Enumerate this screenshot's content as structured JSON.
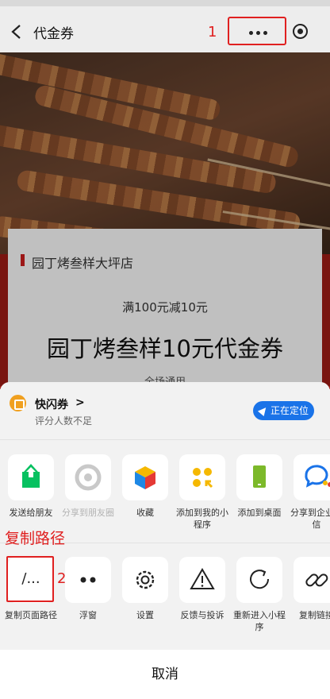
{
  "nav": {
    "title": "代金券",
    "annotation_1": "1"
  },
  "coupon": {
    "shop_name": "园丁烤叁样大坪店",
    "deal": "满100元减10元",
    "title": "园丁烤叁样10元代金券",
    "scope": "全场通用"
  },
  "sheet": {
    "app_name": "快闪券",
    "app_chevron": ">",
    "rating": "评分人数不足",
    "locating": "正在定位",
    "row1": [
      {
        "label": "发送给朋友",
        "icon": "share-arrow-icon"
      },
      {
        "label": "分享到朋友圈",
        "icon": "moments-icon"
      },
      {
        "label": "收藏",
        "icon": "favorite-cube-icon"
      },
      {
        "label": "添加到我的小程序",
        "icon": "my-mini-program-icon"
      },
      {
        "label": "添加到桌面",
        "icon": "phone-desktop-icon"
      },
      {
        "label": "分享到企业微信",
        "icon": "wecom-icon"
      }
    ],
    "row2": [
      {
        "label": "复制页面路径",
        "icon": "copy-path-icon",
        "glyph": "/..."
      },
      {
        "label": "浮窗",
        "icon": "float-window-icon"
      },
      {
        "label": "设置",
        "icon": "gear-icon"
      },
      {
        "label": "反馈与投诉",
        "icon": "warning-icon"
      },
      {
        "label": "重新进入小程序",
        "icon": "reload-icon"
      },
      {
        "label": "复制链接",
        "icon": "link-icon"
      }
    ],
    "cancel": "取消"
  },
  "annotations": {
    "callout": "复制路径",
    "step_2": "2"
  },
  "colors": {
    "accent_red": "#e02020",
    "locate_blue": "#1a73e8",
    "wechat_green": "#07c160"
  }
}
